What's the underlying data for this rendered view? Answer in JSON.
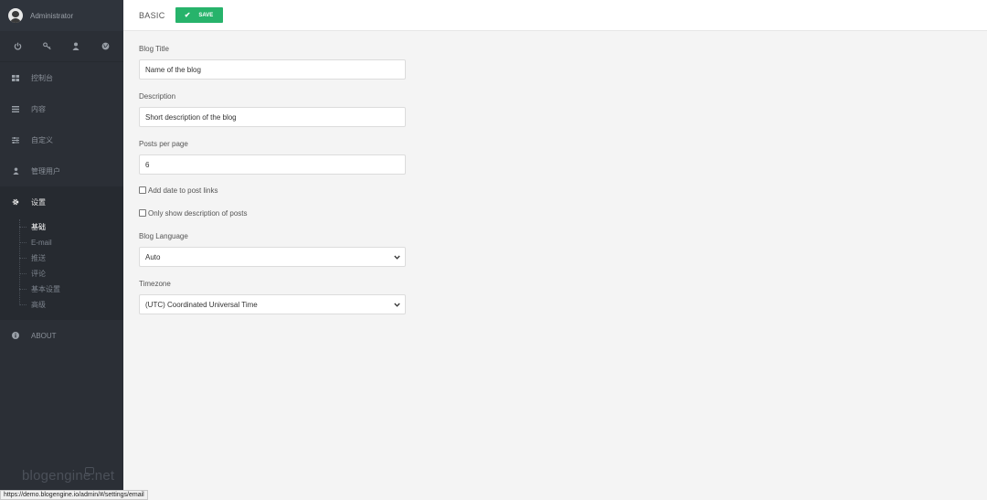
{
  "sidebar": {
    "user_name": "Administrator",
    "quick_icons": [
      "power-icon",
      "key-icon",
      "user-icon",
      "globe-icon"
    ],
    "menu": [
      {
        "icon": "dashboard-icon",
        "label": "控制台"
      },
      {
        "icon": "content-icon",
        "label": "内容"
      },
      {
        "icon": "customize-icon",
        "label": "自定义"
      },
      {
        "icon": "users-icon",
        "label": "管理用户"
      },
      {
        "icon": "gear-icon",
        "label": "设置"
      }
    ],
    "settings_submenu": [
      "基础",
      "E-mail",
      "推送",
      "评论",
      "基本设置",
      "高级"
    ],
    "about": "ABOUT",
    "brand": "blogengine.net"
  },
  "topbar": {
    "title": "BASIC",
    "save_label": "SAVE"
  },
  "form": {
    "blog_title_label": "Blog Title",
    "blog_title_value": "Name of the blog",
    "description_label": "Description",
    "description_value": "Short description of the blog",
    "posts_per_page_label": "Posts per page",
    "posts_per_page_value": "6",
    "add_date_label": "Add date to post links",
    "only_description_label": "Only show description of posts",
    "language_label": "Blog Language",
    "language_value": "Auto",
    "timezone_label": "Timezone",
    "timezone_value": "(UTC) Coordinated Universal Time"
  },
  "status_bar": {
    "url": "https://demo.blogengine.io/admin/#/settings/email"
  },
  "colors": {
    "sidebar_bg": "#2b2f36",
    "accent_green": "#27b36b",
    "page_bg": "#f4f4f4"
  }
}
